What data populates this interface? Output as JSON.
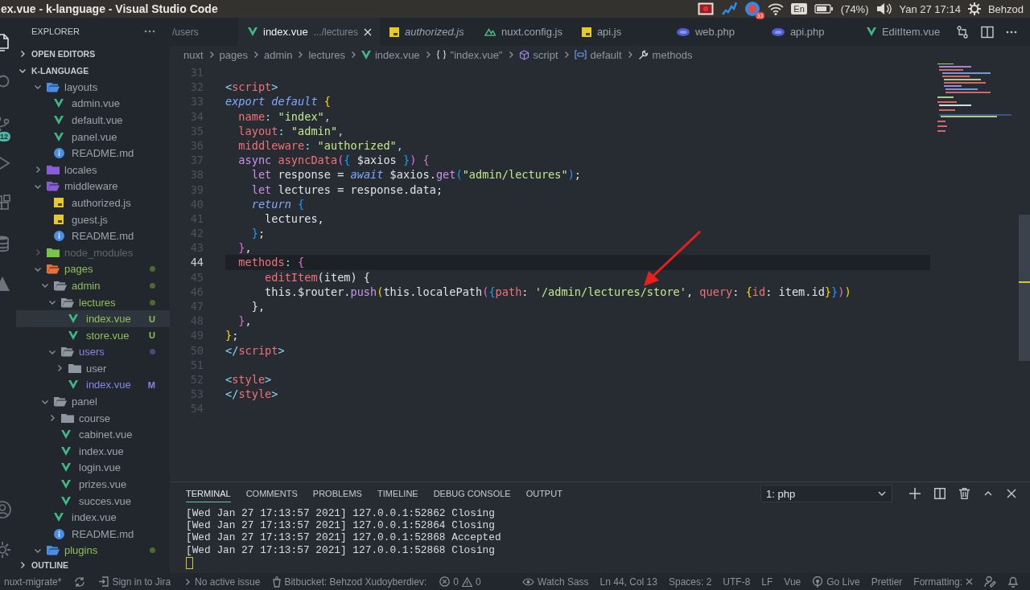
{
  "system_bar": {
    "title": "ex.vue - k-language - Visual Studio Code",
    "tray": [
      {
        "kind": "record"
      },
      {
        "kind": "chart"
      },
      {
        "kind": "app",
        "badge": "33"
      },
      {
        "kind": "wifi"
      },
      {
        "kind": "keyboard",
        "label": "En"
      },
      {
        "kind": "battery",
        "label": "(74%)"
      },
      {
        "kind": "volume"
      },
      {
        "kind": "clock",
        "label": "Yan 27 17:14"
      },
      {
        "kind": "user",
        "label": "Behzod"
      }
    ]
  },
  "activity_bar": [
    {
      "kind": "files",
      "selected": true
    },
    {
      "kind": "search",
      "selected": false
    },
    {
      "kind": "source-control",
      "selected": false,
      "badge": "12"
    },
    {
      "kind": "run",
      "selected": false
    },
    {
      "kind": "extensions",
      "selected": false
    },
    {
      "kind": "database",
      "selected": false
    },
    {
      "kind": "triangle",
      "selected": false
    },
    {
      "kind": "account",
      "selected": false
    },
    {
      "kind": "settings",
      "selected": false
    }
  ],
  "sidebar": {
    "title": "EXPLORER",
    "sections": [
      {
        "label": "OPEN EDITORS",
        "expanded": false
      },
      {
        "label": "K-LANGUAGE",
        "expanded": true,
        "tree": [
          {
            "name": "layouts",
            "kind": "folder",
            "color": "#4a8fe7",
            "expanded": true,
            "selected": false,
            "untracked": false,
            "modified": false,
            "ignored": false,
            "children": [
              {
                "name": "admin.vue",
                "kind": "vue",
                "selected": false,
                "untracked": false,
                "modified": false,
                "ignored": false
              },
              {
                "name": "default.vue",
                "kind": "vue",
                "selected": false,
                "untracked": false,
                "modified": false,
                "ignored": false
              },
              {
                "name": "panel.vue",
                "kind": "vue",
                "selected": false,
                "untracked": false,
                "modified": false,
                "ignored": false
              },
              {
                "name": "README.md",
                "kind": "md",
                "selected": false,
                "untracked": false,
                "modified": false,
                "ignored": false
              }
            ]
          },
          {
            "name": "locales",
            "kind": "folder",
            "color": "#8a5cd8",
            "expanded": false,
            "selected": false,
            "untracked": false,
            "modified": false,
            "ignored": false
          },
          {
            "name": "middleware",
            "kind": "folder",
            "color": "#8a5cd8",
            "expanded": true,
            "selected": false,
            "untracked": false,
            "modified": false,
            "ignored": false,
            "children": [
              {
                "name": "authorized.js",
                "kind": "js",
                "selected": false,
                "untracked": false,
                "modified": false,
                "ignored": false
              },
              {
                "name": "guest.js",
                "kind": "js",
                "selected": false,
                "untracked": false,
                "modified": false,
                "ignored": false
              },
              {
                "name": "README.md",
                "kind": "md",
                "selected": false,
                "untracked": false,
                "modified": false,
                "ignored": false
              }
            ]
          },
          {
            "name": "node_modules",
            "kind": "folder",
            "color": "#7cc34a",
            "expanded": false,
            "selected": false,
            "untracked": false,
            "modified": false,
            "ignored": true
          },
          {
            "name": "pages",
            "kind": "folder",
            "color": "#e8703a",
            "expanded": true,
            "selected": false,
            "untracked": true,
            "modified": false,
            "ignored": false,
            "children": [
              {
                "name": "admin",
                "kind": "folder",
                "color": "#8e979f",
                "expanded": true,
                "selected": false,
                "untracked": true,
                "modified": false,
                "ignored": false,
                "children": [
                  {
                    "name": "lectures",
                    "kind": "folder",
                    "color": "#8e979f",
                    "expanded": true,
                    "selected": false,
                    "untracked": true,
                    "modified": false,
                    "ignored": false,
                    "children": [
                      {
                        "name": "index.vue",
                        "kind": "vue",
                        "selected": true,
                        "untracked": true,
                        "modified": false,
                        "ignored": false,
                        "badge": "U"
                      },
                      {
                        "name": "store.vue",
                        "kind": "vue",
                        "selected": false,
                        "untracked": true,
                        "modified": false,
                        "ignored": false,
                        "badge": "U"
                      }
                    ]
                  },
                  {
                    "name": "users",
                    "kind": "folder",
                    "color": "#8e979f",
                    "expanded": true,
                    "selected": false,
                    "untracked": false,
                    "modified": true,
                    "ignored": false,
                    "children": [
                      {
                        "name": "user",
                        "kind": "folder",
                        "color": "#8e979f",
                        "expanded": false,
                        "selected": false,
                        "untracked": false,
                        "modified": false,
                        "ignored": false
                      },
                      {
                        "name": "index.vue",
                        "kind": "vue",
                        "selected": false,
                        "untracked": false,
                        "modified": true,
                        "ignored": false,
                        "badge": "M"
                      }
                    ]
                  }
                ]
              },
              {
                "name": "panel",
                "kind": "folder",
                "color": "#8e979f",
                "expanded": true,
                "selected": false,
                "untracked": false,
                "modified": false,
                "ignored": false,
                "children": [
                  {
                    "name": "course",
                    "kind": "folder",
                    "color": "#8e979f",
                    "expanded": false,
                    "selected": false,
                    "untracked": false,
                    "modified": false,
                    "ignored": false
                  },
                  {
                    "name": "cabinet.vue",
                    "kind": "vue",
                    "selected": false,
                    "untracked": false,
                    "modified": false,
                    "ignored": false
                  },
                  {
                    "name": "index.vue",
                    "kind": "vue",
                    "selected": false,
                    "untracked": false,
                    "modified": false,
                    "ignored": false
                  },
                  {
                    "name": "login.vue",
                    "kind": "vue",
                    "selected": false,
                    "untracked": false,
                    "modified": false,
                    "ignored": false
                  },
                  {
                    "name": "prizes.vue",
                    "kind": "vue",
                    "selected": false,
                    "untracked": false,
                    "modified": false,
                    "ignored": false
                  },
                  {
                    "name": "succes.vue",
                    "kind": "vue",
                    "selected": false,
                    "untracked": false,
                    "modified": false,
                    "ignored": false
                  }
                ]
              },
              {
                "name": "index.vue",
                "kind": "vue",
                "selected": false,
                "untracked": false,
                "modified": false,
                "ignored": false
              },
              {
                "name": "README.md",
                "kind": "md",
                "selected": false,
                "untracked": false,
                "modified": false,
                "ignored": false
              }
            ]
          },
          {
            "name": "plugins",
            "kind": "folder",
            "color": "#4a8fe7",
            "expanded": true,
            "selected": false,
            "untracked": true,
            "modified": false,
            "ignored": false
          }
        ]
      },
      {
        "label": "OUTLINE",
        "expanded": false
      }
    ]
  },
  "tabs": [
    {
      "description": "/users",
      "selected": false,
      "preview": false
    },
    {
      "label": "index.vue",
      "description": ".../lectures",
      "kind": "vue",
      "selected": true,
      "preview": false
    },
    {
      "label": "authorized.js",
      "kind": "js",
      "selected": false,
      "preview": true
    },
    {
      "label": "nuxt.config.js",
      "kind": "nuxt",
      "selected": false,
      "preview": false
    },
    {
      "label": "api.js",
      "kind": "js",
      "selected": false,
      "preview": false
    },
    {
      "label": "web.php",
      "kind": "php",
      "selected": false,
      "preview": false
    },
    {
      "label": "api.php",
      "kind": "php",
      "selected": false,
      "preview": false
    },
    {
      "label": "EditItem.vue",
      "kind": "vue",
      "selected": false,
      "preview": false
    }
  ],
  "breadcrumbs": [
    {
      "label": "nuxt",
      "kind": "folder"
    },
    {
      "label": "pages",
      "kind": "folder"
    },
    {
      "label": "admin",
      "kind": "folder"
    },
    {
      "label": "lectures",
      "kind": "folder"
    },
    {
      "label": "index.vue",
      "kind": "vue"
    },
    {
      "label": "\"index.vue\"",
      "kind": "module"
    },
    {
      "label": "script",
      "kind": "element"
    },
    {
      "label": "default",
      "kind": "variable"
    },
    {
      "label": "methods",
      "kind": "wrench"
    }
  ],
  "editor": {
    "lines": [
      {
        "number": "31",
        "current": false
      },
      {
        "number": "32",
        "current": false,
        "tokens": [
          {
            "text": "<",
            "kind": "punct"
          },
          {
            "text": "script",
            "kind": "tag"
          },
          {
            "text": ">",
            "kind": "punct"
          }
        ]
      },
      {
        "number": "33",
        "current": false,
        "tokens": [
          {
            "text": "export default",
            "kind": "kwi"
          },
          {
            "text": " {",
            "kind": "b1"
          }
        ]
      },
      {
        "number": "34",
        "current": false,
        "tokens": [
          {
            "text": "  name",
            "kind": "prop"
          },
          {
            "text": ": ",
            "kind": "punct"
          },
          {
            "text": "\"index\"",
            "kind": "str"
          },
          {
            "text": ",",
            "kind": "punct"
          }
        ]
      },
      {
        "number": "35",
        "current": false,
        "tokens": [
          {
            "text": "  layout",
            "kind": "prop"
          },
          {
            "text": ": ",
            "kind": "punct"
          },
          {
            "text": "\"admin\"",
            "kind": "str"
          },
          {
            "text": ",",
            "kind": "punct"
          }
        ]
      },
      {
        "number": "36",
        "current": false,
        "tokens": [
          {
            "text": "  middleware",
            "kind": "prop"
          },
          {
            "text": ": ",
            "kind": "punct"
          },
          {
            "text": "\"authorized\"",
            "kind": "str"
          },
          {
            "text": ",",
            "kind": "punct"
          }
        ]
      },
      {
        "number": "37",
        "current": false,
        "tokens": [
          {
            "text": "  async",
            "kind": "kw"
          },
          {
            "text": " asyncData",
            "kind": "fn"
          },
          {
            "text": "(",
            "kind": "b2"
          },
          {
            "text": "{",
            "kind": "b3"
          },
          {
            "text": " $axios ",
            "kind": "plain"
          },
          {
            "text": "}",
            "kind": "b3"
          },
          {
            "text": ")",
            "kind": "b2"
          },
          {
            "text": " {",
            "kind": "b2"
          }
        ]
      },
      {
        "number": "38",
        "current": false,
        "tokens": [
          {
            "text": "    let",
            "kind": "kw"
          },
          {
            "text": " response = ",
            "kind": "plain"
          },
          {
            "text": "await",
            "kind": "kwi"
          },
          {
            "text": " $axios.",
            "kind": "plain"
          },
          {
            "text": "get",
            "kind": "method"
          },
          {
            "text": "(",
            "kind": "b3"
          },
          {
            "text": "\"admin/lectures\"",
            "kind": "str"
          },
          {
            "text": ")",
            "kind": "b3"
          },
          {
            "text": ";",
            "kind": "plain"
          }
        ]
      },
      {
        "number": "39",
        "current": false,
        "tokens": [
          {
            "text": "    let",
            "kind": "kw"
          },
          {
            "text": " lectures = response.data;",
            "kind": "plain"
          }
        ]
      },
      {
        "number": "40",
        "current": false,
        "tokens": [
          {
            "text": "    return",
            "kind": "kwi"
          },
          {
            "text": " {",
            "kind": "b3"
          }
        ]
      },
      {
        "number": "41",
        "current": false,
        "tokens": [
          {
            "text": "      lectures,",
            "kind": "plain"
          }
        ]
      },
      {
        "number": "42",
        "current": false,
        "tokens": [
          {
            "text": "    }",
            "kind": "b3"
          },
          {
            "text": ";",
            "kind": "plain"
          }
        ]
      },
      {
        "number": "43",
        "current": false,
        "tokens": [
          {
            "text": "  }",
            "kind": "b2"
          },
          {
            "text": ",",
            "kind": "plain"
          }
        ]
      },
      {
        "number": "44",
        "current": true,
        "tokens": [
          {
            "text": "  methods",
            "kind": "prop"
          },
          {
            "text": ": ",
            "kind": "punct"
          },
          {
            "text": "{",
            "kind": "b2"
          }
        ]
      },
      {
        "number": "45",
        "current": false,
        "tokens": [
          {
            "text": "      editItem",
            "kind": "fn"
          },
          {
            "text": "(item) {",
            "kind": "plain"
          }
        ]
      },
      {
        "number": "46",
        "current": false,
        "tokens": [
          {
            "text": "      this.$router.",
            "kind": "plain"
          },
          {
            "text": "push",
            "kind": "method"
          },
          {
            "text": "(",
            "kind": "b1"
          },
          {
            "text": "this.localePath",
            "kind": "plain"
          },
          {
            "text": "(",
            "kind": "b2"
          },
          {
            "text": "{",
            "kind": "b3"
          },
          {
            "text": "path",
            "kind": "prop"
          },
          {
            "text": ": ",
            "kind": "plain"
          },
          {
            "text": "'/admin/lectures/store'",
            "kind": "str"
          },
          {
            "text": ", ",
            "kind": "plain"
          },
          {
            "text": "query",
            "kind": "prop"
          },
          {
            "text": ": ",
            "kind": "plain"
          },
          {
            "text": "{",
            "kind": "b1"
          },
          {
            "text": "id",
            "kind": "prop"
          },
          {
            "text": ": item.id",
            "kind": "plain"
          },
          {
            "text": "}",
            "kind": "b1"
          },
          {
            "text": "}",
            "kind": "b3"
          },
          {
            "text": ")",
            "kind": "b2"
          },
          {
            "text": ")",
            "kind": "b1"
          }
        ]
      },
      {
        "number": "47",
        "current": false,
        "tokens": [
          {
            "text": "    },",
            "kind": "plain"
          }
        ]
      },
      {
        "number": "48",
        "current": false,
        "tokens": [
          {
            "text": "  }",
            "kind": "b2"
          },
          {
            "text": ",",
            "kind": "plain"
          }
        ]
      },
      {
        "number": "49",
        "current": false,
        "tokens": [
          {
            "text": "}",
            "kind": "b1"
          },
          {
            "text": ";",
            "kind": "plain"
          }
        ]
      },
      {
        "number": "50",
        "current": false,
        "tokens": [
          {
            "text": "</",
            "kind": "punct"
          },
          {
            "text": "script",
            "kind": "tag"
          },
          {
            "text": ">",
            "kind": "punct"
          }
        ]
      },
      {
        "number": "51",
        "current": false
      },
      {
        "number": "52",
        "current": false,
        "tokens": [
          {
            "text": "<",
            "kind": "punct"
          },
          {
            "text": "style",
            "kind": "tag"
          },
          {
            "text": ">",
            "kind": "punct"
          }
        ]
      },
      {
        "number": "53",
        "current": false,
        "tokens": [
          {
            "text": "</",
            "kind": "punct"
          },
          {
            "text": "style",
            "kind": "tag"
          },
          {
            "text": ">",
            "kind": "punct"
          }
        ]
      },
      {
        "number": "54",
        "current": false
      }
    ]
  },
  "panel": {
    "tabs": [
      {
        "label": "TERMINAL",
        "selected": true
      },
      {
        "label": "COMMENTS",
        "selected": false
      },
      {
        "label": "PROBLEMS",
        "selected": false
      },
      {
        "label": "TIMELINE",
        "selected": false
      },
      {
        "label": "DEBUG CONSOLE",
        "selected": false
      },
      {
        "label": "OUTPUT",
        "selected": false
      }
    ],
    "terminal_select": "1: php",
    "terminal_lines": [
      "[Wed Jan 27 17:13:57 2021] 127.0.0.1:52862 Closing",
      "[Wed Jan 27 17:13:57 2021] 127.0.0.1:52864 Closing",
      "[Wed Jan 27 17:13:57 2021] 127.0.0.1:52868 Accepted",
      "[Wed Jan 27 17:13:57 2021] 127.0.0.1:52868 Closing"
    ]
  },
  "status_bar": {
    "left": [
      {
        "kind": "text",
        "label": "nuxt-migrate*"
      },
      {
        "kind": "sync"
      },
      {
        "kind": "jira",
        "label": "Sign in to Jira"
      },
      {
        "kind": "issue",
        "label": "No active issue"
      },
      {
        "kind": "bitbucket",
        "label": "Bitbucket: Behzod Xudoyberdiev:"
      },
      {
        "kind": "problems",
        "errors": "0",
        "warnings": "0"
      }
    ],
    "right": [
      {
        "kind": "eye",
        "label": "Watch Sass"
      },
      {
        "kind": "text",
        "label": "Ln 44, Col 13"
      },
      {
        "kind": "text",
        "label": "Spaces: 2"
      },
      {
        "kind": "text",
        "label": "UTF-8"
      },
      {
        "kind": "text",
        "label": "LF"
      },
      {
        "kind": "text",
        "label": "Vue"
      },
      {
        "kind": "golive",
        "label": "Go Live"
      },
      {
        "kind": "text",
        "label": "Prettier"
      },
      {
        "kind": "formatting",
        "label": "Formatting:"
      },
      {
        "kind": "feedback"
      },
      {
        "kind": "bell"
      }
    ]
  }
}
